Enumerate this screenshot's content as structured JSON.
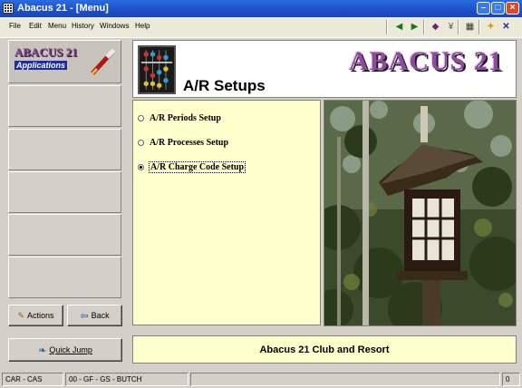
{
  "window": {
    "title": "Abacus 21 - [Menu]"
  },
  "menubar": {
    "items": [
      "File",
      "Edit",
      "Menu",
      "History",
      "Windows",
      "Help"
    ]
  },
  "toolbar": {
    "icons": [
      "arrow-left-icon",
      "arrow-right-icon",
      "book-icon",
      "bug-icon",
      "calculator-icon",
      "runner-icon",
      "close-icon"
    ]
  },
  "sidebar": {
    "logo_line1": "ABACUS 21",
    "logo_line2": "Applications",
    "actions_label": "Actions",
    "back_label": "Back",
    "quick_jump_label": "Quick Jump"
  },
  "header": {
    "page_title": "A/R Setups",
    "brand": "ABACUS 21"
  },
  "options": [
    {
      "label": "A/R Periods Setup",
      "selected": false
    },
    {
      "label": "A/R Processes Setup",
      "selected": false
    },
    {
      "label": "A/R Charge Code Setup",
      "selected": true
    }
  ],
  "footer": {
    "text": "Abacus 21 Club and Resort"
  },
  "statusbar": {
    "left": "CAR - CAS",
    "middle": "00 - GF - GS - BUTCH",
    "right": "0"
  },
  "colors": {
    "titlebar": "#1c4fc8",
    "panel": "#ffffcc",
    "brand": "#8e4d9c"
  }
}
